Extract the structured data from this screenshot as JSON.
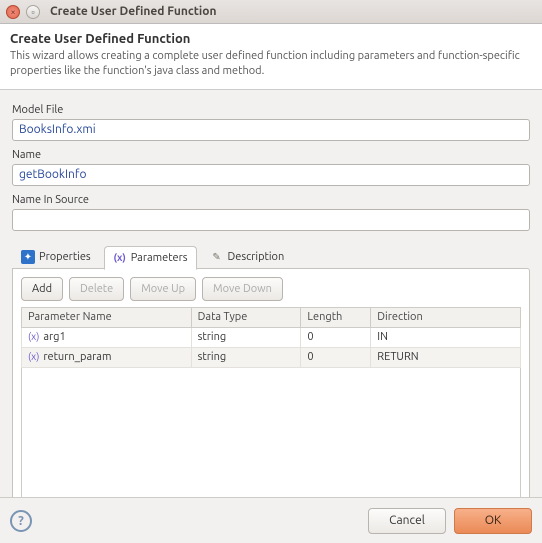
{
  "window": {
    "title": "Create User Defined Function"
  },
  "header": {
    "title": "Create User Defined Function",
    "desc": "This wizard allows creating a complete user defined function including parameters and function-specific properties like the function's java class and method."
  },
  "fields": {
    "modelFile": {
      "label": "Model File",
      "value": "BooksInfo.xmi"
    },
    "name": {
      "label": "Name",
      "value": "getBookInfo"
    },
    "nameInSource": {
      "label": "Name In Source",
      "value": ""
    }
  },
  "tabs": {
    "properties": "Properties",
    "parameters": "Parameters",
    "description": "Description"
  },
  "buttons": {
    "add": "Add",
    "delete": "Delete",
    "moveUp": "Move Up",
    "moveDown": "Move Down"
  },
  "columns": {
    "paramName": "Parameter Name",
    "dataType": "Data Type",
    "length": "Length",
    "direction": "Direction"
  },
  "rows": [
    {
      "name": "arg1",
      "type": "string",
      "length": "0",
      "dir": "IN"
    },
    {
      "name": "return_param",
      "type": "string",
      "length": "0",
      "dir": "RETURN"
    }
  ],
  "footer": {
    "cancel": "Cancel",
    "ok": "OK"
  }
}
